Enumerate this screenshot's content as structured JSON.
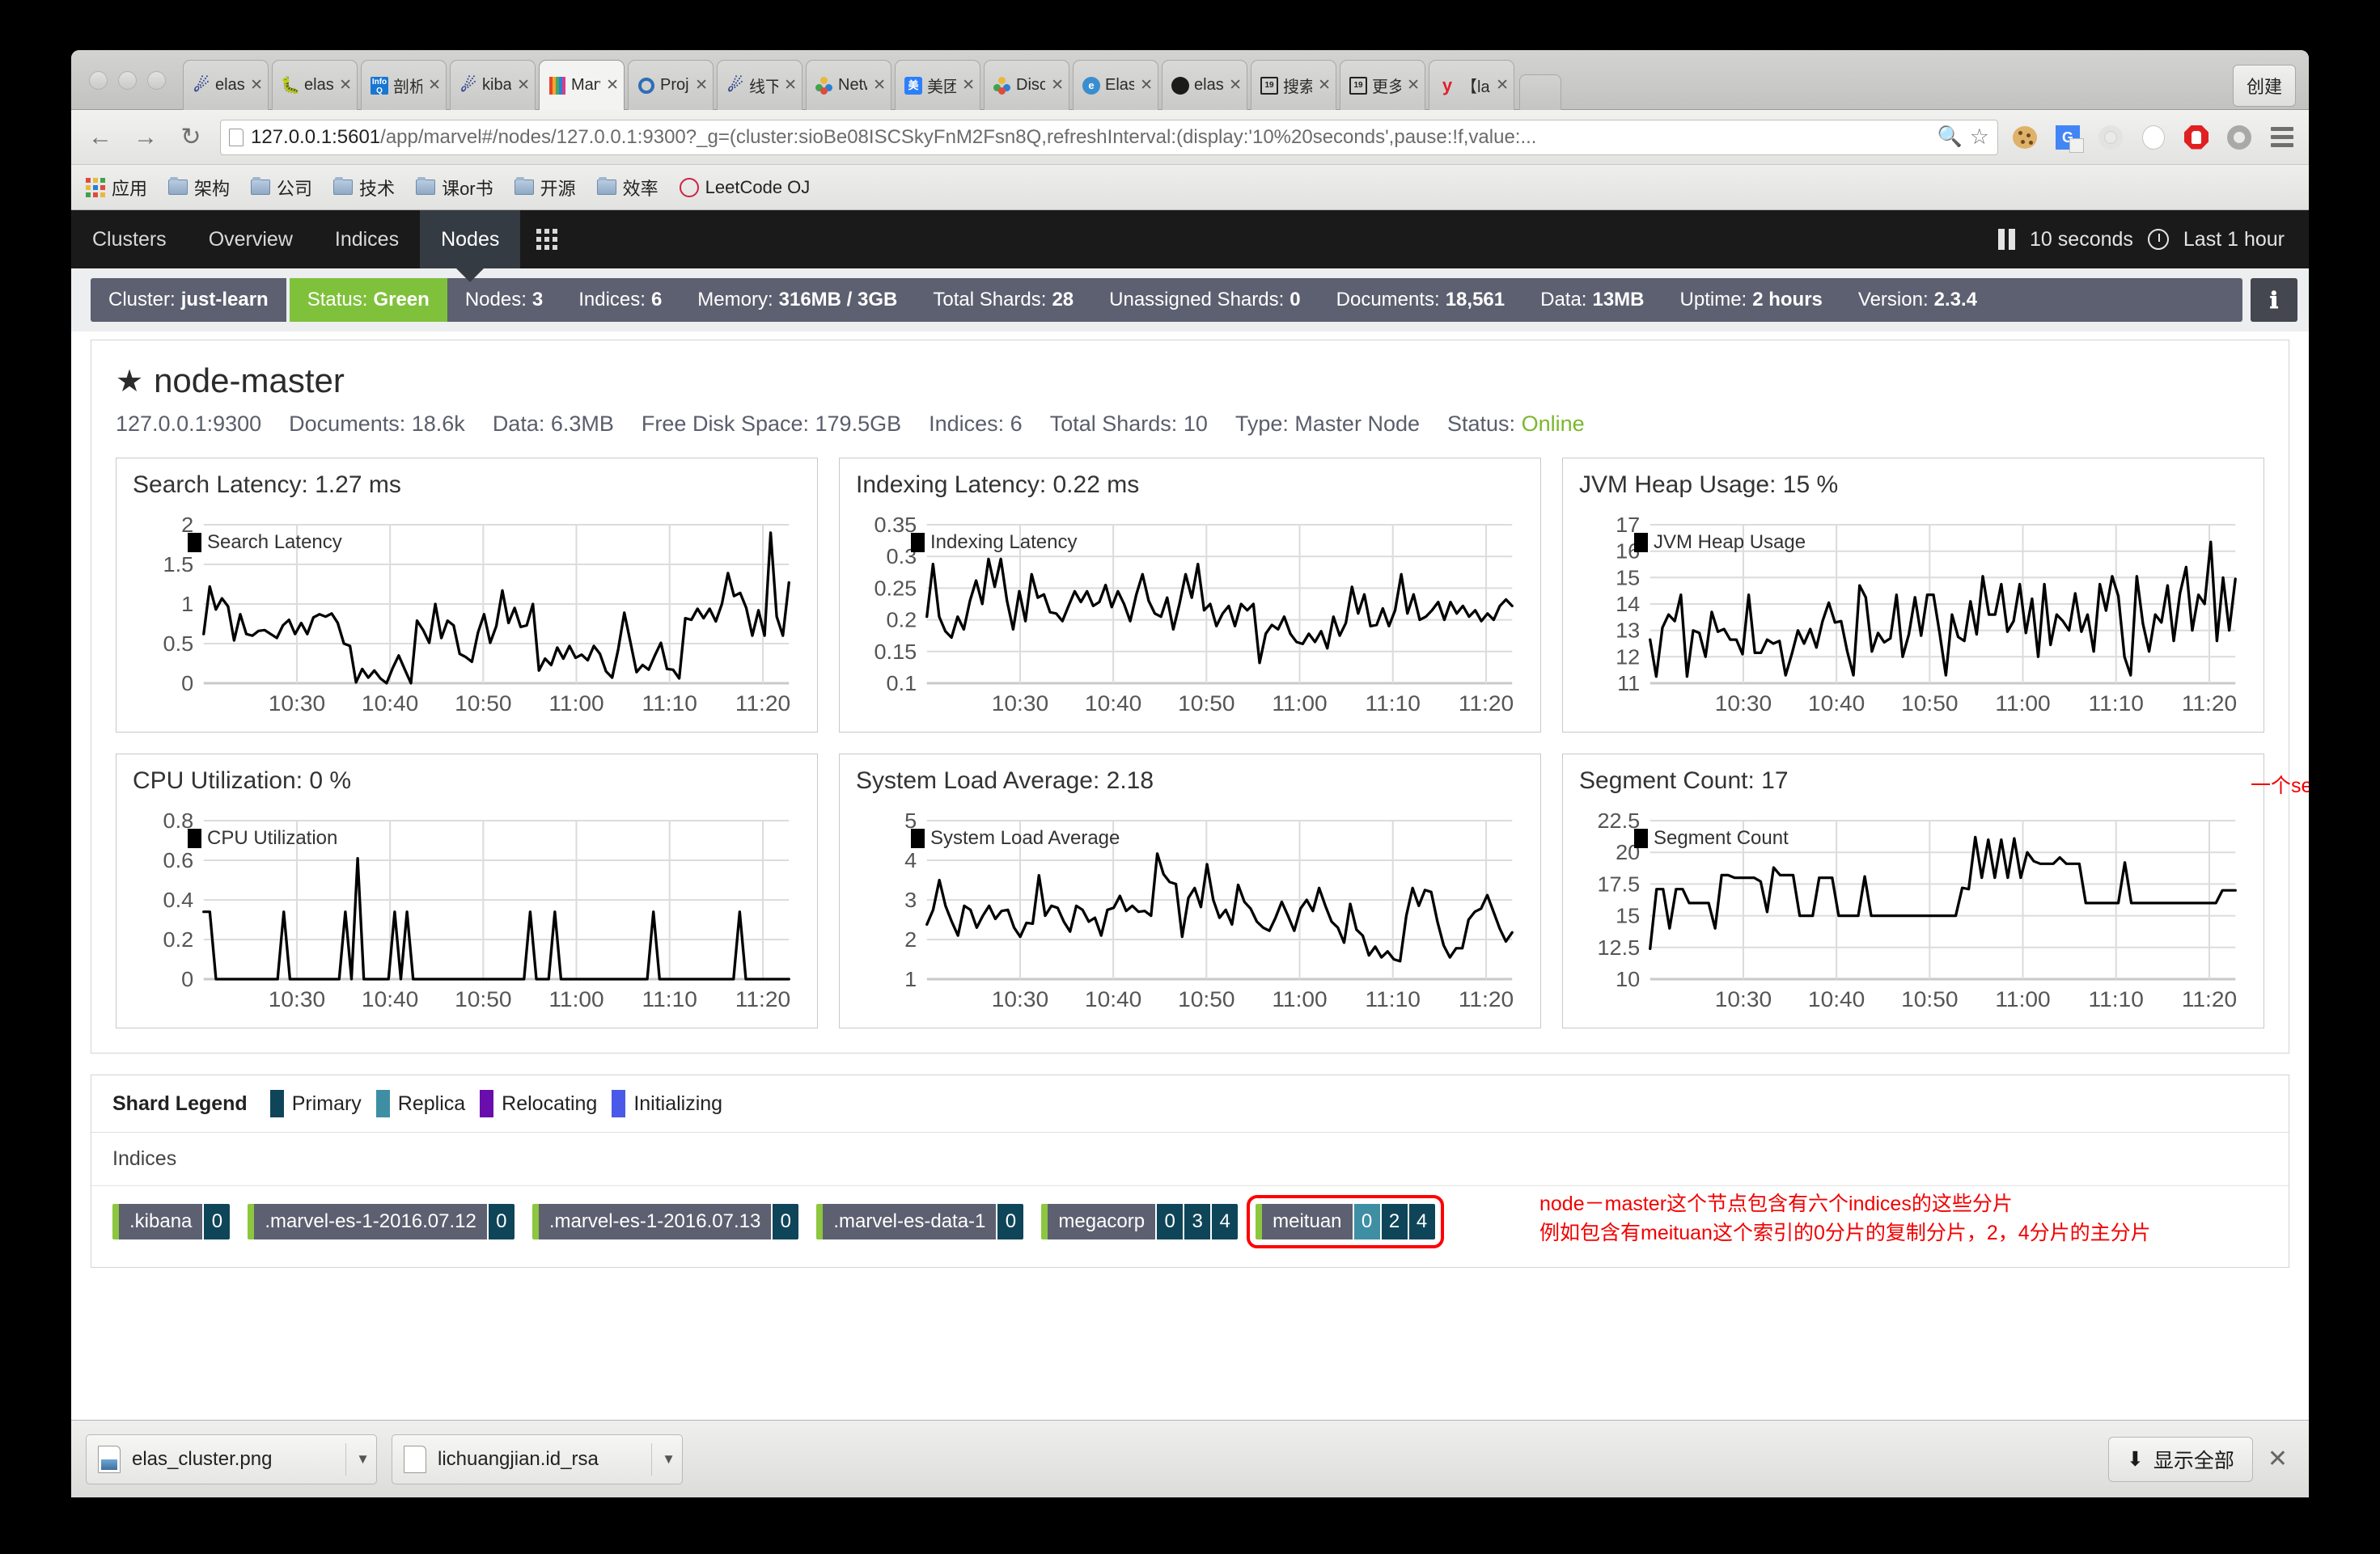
{
  "browser": {
    "create_button": "创建",
    "tabs": [
      {
        "label": "elasti",
        "icon": "elasticsearch-icon",
        "active": false
      },
      {
        "label": "elasti",
        "icon": "bug-icon",
        "active": false
      },
      {
        "label": "剖析E",
        "icon": "infoq-icon",
        "active": false
      },
      {
        "label": "kiban",
        "icon": "elasticsearch-icon",
        "active": false
      },
      {
        "label": "Marve",
        "icon": "marvel-icon",
        "active": true
      },
      {
        "label": "Proje",
        "icon": "target-icon",
        "active": false
      },
      {
        "label": "线下店",
        "icon": "elasticsearch-icon",
        "active": false
      },
      {
        "label": "Netw",
        "icon": "people-icon",
        "active": false
      },
      {
        "label": "美团云",
        "icon": "meituan-icon",
        "active": false
      },
      {
        "label": "Disco",
        "icon": "people-icon",
        "active": false
      },
      {
        "label": "Elasti",
        "icon": "elastic-circle-icon",
        "active": false
      },
      {
        "label": "elasti",
        "icon": "github-icon",
        "active": false
      },
      {
        "label": "搜索 |",
        "icon": "book-icon",
        "active": false
      },
      {
        "label": "更多打",
        "icon": "book-icon",
        "active": false
      },
      {
        "label": "【late",
        "icon": "y-icon",
        "active": false
      }
    ],
    "url_scheme": "127.0.0.1:5601",
    "url_rest": "/app/marvel#/nodes/127.0.0.1:9300?_g=(cluster:sioBe08ISCSkyFnM2Fsn8Q,refreshInterval:(display:'10%20seconds',pause:!f,value:...",
    "toolbar_icons": [
      "zoom-out-icon",
      "bookmark-star-icon",
      "cookie-icon",
      "google-translate-icon",
      "ring-icon",
      "document-icon",
      "adblock-icon",
      "circle-icon",
      "browser-menu-icon"
    ],
    "bookmarks": [
      {
        "label": "应用",
        "icon": "apps-grid-icon"
      },
      {
        "label": "架构",
        "icon": "folder-icon"
      },
      {
        "label": "公司",
        "icon": "folder-icon"
      },
      {
        "label": "技术",
        "icon": "folder-icon"
      },
      {
        "label": "课or书",
        "icon": "folder-icon"
      },
      {
        "label": "开源",
        "icon": "folder-icon"
      },
      {
        "label": "效率",
        "icon": "folder-icon"
      },
      {
        "label": "LeetCode OJ",
        "icon": "leetcode-icon"
      }
    ]
  },
  "marvel_nav": {
    "items": [
      {
        "label": "Clusters",
        "active": false
      },
      {
        "label": "Overview",
        "active": false
      },
      {
        "label": "Indices",
        "active": false
      },
      {
        "label": "Nodes",
        "active": true
      }
    ],
    "grid_icon": "dashboard-grid-icon",
    "refresh_interval": "10 seconds",
    "time_range": "Last 1 hour",
    "pause_icon": "pause-icon",
    "clock_icon": "clock-icon"
  },
  "cluster_status": {
    "items": [
      {
        "label": "Cluster:",
        "value": "just-learn",
        "style": "cluster"
      },
      {
        "label": "Status:",
        "value": "Green",
        "style": "green"
      },
      {
        "label": "Nodes:",
        "value": "3",
        "style": ""
      },
      {
        "label": "Indices:",
        "value": "6",
        "style": ""
      },
      {
        "label": "Memory:",
        "value": "316MB / 3GB",
        "style": ""
      },
      {
        "label": "Total Shards:",
        "value": "28",
        "style": ""
      },
      {
        "label": "Unassigned Shards:",
        "value": "0",
        "style": ""
      },
      {
        "label": "Documents:",
        "value": "18,561",
        "style": ""
      },
      {
        "label": "Data:",
        "value": "13MB",
        "style": ""
      },
      {
        "label": "Uptime:",
        "value": "2 hours",
        "style": ""
      },
      {
        "label": "Version:",
        "value": "2.3.4",
        "style": ""
      }
    ],
    "info_icon": "info-icon"
  },
  "node": {
    "name": "node-master",
    "star_icon": "star-icon",
    "meta": [
      {
        "label": "",
        "value": "127.0.0.1:9300"
      },
      {
        "label": "Documents:",
        "value": "18.6k"
      },
      {
        "label": "Data:",
        "value": "6.3MB"
      },
      {
        "label": "Free Disk Space:",
        "value": "179.5GB"
      },
      {
        "label": "Indices:",
        "value": "6"
      },
      {
        "label": "Total Shards:",
        "value": "10"
      },
      {
        "label": "Type:",
        "value": "Master Node"
      },
      {
        "label": "Status:",
        "value": "Online",
        "accent": "#7bb72e"
      }
    ]
  },
  "annotations": {
    "segment_inline": "一个segment是一个完备的lucene倒排索引",
    "shard_line1": "node－master这个节点包含有六个indices的这些分片",
    "shard_line2": "例如包含有meituan这个索引的0分片的复制分片，2，4分片的主分片",
    "color": "#f20000"
  },
  "shard_legend": {
    "title": "Shard Legend",
    "items": [
      {
        "label": "Primary",
        "color": "#0f4559"
      },
      {
        "label": "Replica",
        "color": "#3e8fa3"
      },
      {
        "label": "Relocating",
        "color": "#6a0dad"
      },
      {
        "label": "Initializing",
        "color": "#4a5ae8"
      }
    ],
    "indices_label": "Indices",
    "indices": [
      {
        "name": ".kibana",
        "shards": [
          {
            "num": "0",
            "type": "primary"
          }
        ],
        "highlight": false
      },
      {
        "name": ".marvel-es-1-2016.07.12",
        "shards": [
          {
            "num": "0",
            "type": "primary"
          }
        ],
        "highlight": false
      },
      {
        "name": ".marvel-es-1-2016.07.13",
        "shards": [
          {
            "num": "0",
            "type": "primary"
          }
        ],
        "highlight": false
      },
      {
        "name": ".marvel-es-data-1",
        "shards": [
          {
            "num": "0",
            "type": "primary"
          }
        ],
        "highlight": false
      },
      {
        "name": "megacorp",
        "shards": [
          {
            "num": "0",
            "type": "primary"
          },
          {
            "num": "3",
            "type": "primary"
          },
          {
            "num": "4",
            "type": "primary"
          }
        ],
        "highlight": false
      },
      {
        "name": "meituan",
        "shards": [
          {
            "num": "0",
            "type": "replica"
          },
          {
            "num": "2",
            "type": "primary"
          },
          {
            "num": "4",
            "type": "primary"
          }
        ],
        "highlight": true
      }
    ]
  },
  "downloads": {
    "files": [
      {
        "name": "elas_cluster.png",
        "icon": "image-file-icon"
      },
      {
        "name": "lichuangjian.id_rsa",
        "icon": "file-icon"
      }
    ],
    "show_all": "显示全部",
    "show_all_icon": "download-icon",
    "close_icon": "close-icon"
  },
  "chart_data": [
    {
      "type": "line",
      "title": "Search Latency: 1.27 ms",
      "legend": "Search Latency",
      "ylabel": "",
      "xlabel": "",
      "ylim": [
        0,
        2
      ],
      "yticks": [
        0,
        0.5,
        1,
        1.5,
        2
      ],
      "xticks": [
        "10:30",
        "10:40",
        "10:50",
        "11:00",
        "11:10",
        "11:20"
      ],
      "grid": true,
      "legend_position": "top-left",
      "values": [
        0.62,
        1.22,
        0.93,
        1.07,
        0.97,
        0.54,
        0.87,
        0.62,
        0.6,
        0.66,
        0.67,
        0.62,
        0.57,
        0.73,
        0.8,
        0.62,
        0.76,
        0.62,
        0.83,
        0.87,
        0.84,
        0.88,
        0.76,
        0.5,
        0.47,
        0.01,
        0.18,
        0.07,
        0.16,
        0.06,
        0,
        0.19,
        0.35,
        0.17,
        0,
        0.79,
        0.67,
        0.51,
        1.0,
        0.57,
        0.79,
        0.73,
        0.37,
        0.33,
        0.27,
        0.64,
        0.87,
        0.51,
        0.72,
        1.17,
        0.76,
        0.95,
        0.71,
        0.73,
        1.0,
        0.16,
        0.31,
        0.23,
        0.45,
        0.31,
        0.47,
        0.32,
        0.36,
        0.29,
        0.47,
        0.37,
        0.15,
        0.07,
        0.43,
        0.89,
        0.52,
        0.14,
        0.23,
        0.17,
        0.35,
        0.51,
        0.18,
        0.17,
        0.06,
        0.82,
        0.8,
        0.94,
        0.82,
        0.94,
        0.78,
        1.0,
        1.39,
        1.1,
        1.14,
        0.95,
        0.6,
        0.92,
        0.6,
        1.9,
        0.84,
        0.6,
        1.27
      ]
    },
    {
      "type": "line",
      "title": "Indexing Latency: 0.22 ms",
      "legend": "Indexing Latency",
      "ylabel": "",
      "xlabel": "",
      "ylim": [
        0.1,
        0.35
      ],
      "yticks": [
        0.1,
        0.15,
        0.2,
        0.25,
        0.3,
        0.35
      ],
      "xticks": [
        "10:30",
        "10:40",
        "10:50",
        "11:00",
        "11:10",
        "11:20"
      ],
      "grid": true,
      "legend_position": "top-left",
      "values": [
        0.205,
        0.288,
        0.205,
        0.182,
        0.172,
        0.205,
        0.185,
        0.23,
        0.262,
        0.225,
        0.296,
        0.252,
        0.296,
        0.23,
        0.185,
        0.245,
        0.198,
        0.272,
        0.235,
        0.24,
        0.212,
        0.21,
        0.198,
        0.222,
        0.245,
        0.228,
        0.245,
        0.222,
        0.228,
        0.255,
        0.22,
        0.245,
        0.225,
        0.198,
        0.24,
        0.272,
        0.23,
        0.21,
        0.205,
        0.235,
        0.185,
        0.225,
        0.272,
        0.235,
        0.288,
        0.215,
        0.225,
        0.19,
        0.21,
        0.222,
        0.19,
        0.225,
        0.215,
        0.225,
        0.132,
        0.178,
        0.192,
        0.185,
        0.205,
        0.178,
        0.165,
        0.162,
        0.178,
        0.165,
        0.182,
        0.155,
        0.205,
        0.175,
        0.195,
        0.252,
        0.21,
        0.24,
        0.19,
        0.192,
        0.218,
        0.19,
        0.215,
        0.272,
        0.21,
        0.24,
        0.2,
        0.205,
        0.215,
        0.228,
        0.2,
        0.228,
        0.21,
        0.222,
        0.205,
        0.215,
        0.198,
        0.21,
        0.2,
        0.222,
        0.232,
        0.222
      ]
    },
    {
      "type": "line",
      "title": "JVM Heap Usage: 15 %",
      "legend": "JVM Heap Usage",
      "ylabel": "",
      "xlabel": "",
      "ylim": [
        11,
        17
      ],
      "yticks": [
        11,
        12,
        13,
        14,
        15,
        16,
        17
      ],
      "xticks": [
        "10:30",
        "10:40",
        "10:50",
        "11:00",
        "11:10",
        "11:20"
      ],
      "grid": true,
      "legend_position": "top-left",
      "values": [
        12.65,
        11.25,
        13.1,
        13.6,
        13.35,
        14.35,
        11.25,
        13.0,
        12.9,
        12.0,
        13.7,
        12.95,
        13.05,
        12.65,
        12.65,
        12.1,
        14.35,
        12.15,
        12.15,
        12.65,
        12.5,
        12.6,
        11.3,
        12.1,
        13.0,
        12.5,
        13.05,
        12.35,
        13.35,
        14.05,
        13.3,
        13.35,
        12.2,
        11.3,
        14.7,
        14.25,
        12.2,
        12.9,
        12.55,
        12.7,
        14.35,
        12.0,
        12.85,
        14.25,
        12.8,
        14.35,
        14.35,
        12.9,
        11.3,
        13.6,
        12.75,
        12.6,
        14.1,
        12.85,
        15.05,
        13.6,
        13.6,
        14.75,
        12.95,
        13.35,
        14.75,
        12.9,
        14.2,
        12.0,
        14.75,
        12.45,
        13.6,
        13.35,
        13.0,
        14.4,
        12.95,
        13.6,
        12.2,
        14.75,
        13.75,
        15.05,
        14.3,
        12.0,
        11.3,
        15.05,
        13.25,
        12.2,
        13.6,
        13.3,
        14.7,
        12.6,
        14.4,
        15.4,
        13.0,
        14.35,
        14.0,
        16.35,
        12.6,
        15.0,
        13.0,
        14.95
      ]
    },
    {
      "type": "line",
      "title": "CPU Utilization: 0 %",
      "legend": "CPU Utilization",
      "ylabel": "",
      "xlabel": "",
      "ylim": [
        0,
        0.8
      ],
      "yticks": [
        0,
        0.2,
        0.4,
        0.6,
        0.8
      ],
      "xticks": [
        "10:30",
        "10:40",
        "10:50",
        "11:00",
        "11:10",
        "11:20"
      ],
      "grid": true,
      "legend_position": "top-left",
      "values": [
        0.34,
        0.34,
        0,
        0,
        0,
        0,
        0,
        0,
        0,
        0,
        0,
        0,
        0,
        0.34,
        0,
        0,
        0,
        0,
        0,
        0,
        0,
        0,
        0,
        0.34,
        0,
        0.61,
        0,
        0,
        0,
        0,
        0,
        0.34,
        0,
        0.34,
        0,
        0,
        0,
        0,
        0,
        0,
        0,
        0,
        0,
        0,
        0,
        0,
        0,
        0,
        0,
        0,
        0,
        0,
        0,
        0.34,
        0,
        0,
        0,
        0.34,
        0,
        0,
        0,
        0,
        0,
        0,
        0,
        0,
        0,
        0,
        0,
        0,
        0,
        0,
        0,
        0.34,
        0,
        0,
        0,
        0,
        0,
        0,
        0,
        0,
        0,
        0,
        0,
        0,
        0,
        0.34,
        0,
        0,
        0,
        0,
        0,
        0,
        0,
        0
      ]
    },
    {
      "type": "line",
      "title": "System Load Average: 2.18",
      "legend": "System Load Average",
      "ylabel": "",
      "xlabel": "",
      "ylim": [
        1,
        5
      ],
      "yticks": [
        1,
        2,
        3,
        4,
        5
      ],
      "xticks": [
        "10:30",
        "10:40",
        "10:50",
        "11:00",
        "11:10",
        "11:20"
      ],
      "grid": true,
      "legend_position": "top-left",
      "values": [
        2.38,
        2.75,
        3.5,
        2.85,
        2.45,
        2.1,
        2.85,
        2.75,
        2.3,
        2.6,
        2.85,
        2.52,
        2.72,
        2.75,
        2.3,
        2.07,
        2.42,
        2.4,
        3.62,
        2.6,
        2.85,
        2.8,
        2.45,
        2.2,
        2.85,
        2.75,
        2.45,
        2.55,
        2.1,
        2.75,
        2.8,
        3.1,
        2.72,
        2.85,
        2.7,
        2.72,
        2.6,
        4.17,
        3.65,
        3.45,
        3.4,
        2.07,
        3.05,
        3.3,
        2.82,
        3.9,
        3.0,
        2.55,
        2.75,
        2.38,
        3.38,
        2.95,
        2.78,
        2.45,
        2.3,
        2.22,
        2.55,
        2.95,
        2.6,
        2.22,
        2.78,
        3.0,
        2.72,
        3.3,
        2.85,
        2.45,
        2.3,
        1.92,
        2.9,
        2.25,
        2.1,
        1.6,
        1.82,
        1.55,
        1.7,
        1.5,
        1.45,
        2.6,
        3.3,
        2.85,
        3.25,
        3.2,
        2.45,
        1.85,
        1.55,
        1.78,
        1.78,
        2.5,
        2.7,
        2.78,
        3.12,
        2.7,
        2.28,
        1.95,
        2.18
      ]
    },
    {
      "type": "line",
      "title": "Segment Count: 17",
      "legend": "Segment Count",
      "ylabel": "",
      "xlabel": "",
      "ylim": [
        10,
        22.5
      ],
      "yticks": [
        10,
        12.5,
        15,
        17.5,
        20,
        22.5
      ],
      "xticks": [
        "10:30",
        "10:40",
        "10:50",
        "11:00",
        "11:10",
        "11:20"
      ],
      "grid": true,
      "legend_position": "top-left",
      "values": [
        12.4,
        17.1,
        17.1,
        14.0,
        17.1,
        17.1,
        16.0,
        16.0,
        16.0,
        16.0,
        14.0,
        18.2,
        18.2,
        18.0,
        18.0,
        18.0,
        18.0,
        17.7,
        15.3,
        18.8,
        18.2,
        18.2,
        18.2,
        15.0,
        15.0,
        15.0,
        18.0,
        18.0,
        18.0,
        15.0,
        15.0,
        15.0,
        15.0,
        18.1,
        15.0,
        15.0,
        15.0,
        15.0,
        15.0,
        15.0,
        15.0,
        15.0,
        15.0,
        15.0,
        15.0,
        15.0,
        15.0,
        15.0,
        17.2,
        17.1,
        21.2,
        18.0,
        21.0,
        18.0,
        21.0,
        18.0,
        21.1,
        18.0,
        20.0,
        19.3,
        19.1,
        19.1,
        19.1,
        19.6,
        19.1,
        19.1,
        19.1,
        16.0,
        16.0,
        16.0,
        16.0,
        16.0,
        16.0,
        19.2,
        16.0,
        16.0,
        16.0,
        16.0,
        16.0,
        16.0,
        16.0,
        16.0,
        16.0,
        16.0,
        16.0,
        16.0,
        16.0,
        16.0,
        17.0,
        17.0,
        17.0
      ]
    }
  ]
}
